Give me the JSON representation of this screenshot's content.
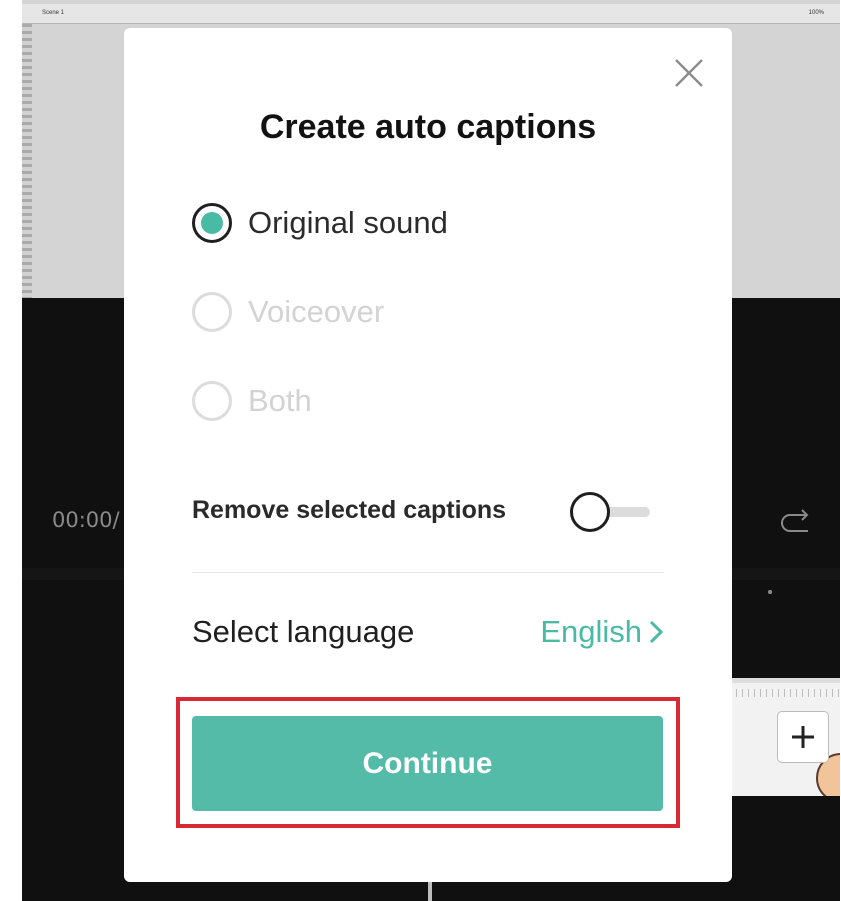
{
  "background": {
    "preview_title": "Scene 1",
    "preview_zoom": "100%",
    "time_readout": "00:00/"
  },
  "dialog": {
    "title": "Create auto captions",
    "sound_options": [
      {
        "label": "Original sound",
        "selected": true,
        "enabled": true
      },
      {
        "label": "Voiceover",
        "selected": false,
        "enabled": false
      },
      {
        "label": "Both",
        "selected": false,
        "enabled": false
      }
    ],
    "remove_captions_label": "Remove selected captions",
    "remove_captions_enabled": false,
    "language_label": "Select language",
    "language_value": "English",
    "continue_label": "Continue"
  },
  "colors": {
    "accent": "#49bba5",
    "button": "#54bba8",
    "highlight": "#d82a34"
  }
}
